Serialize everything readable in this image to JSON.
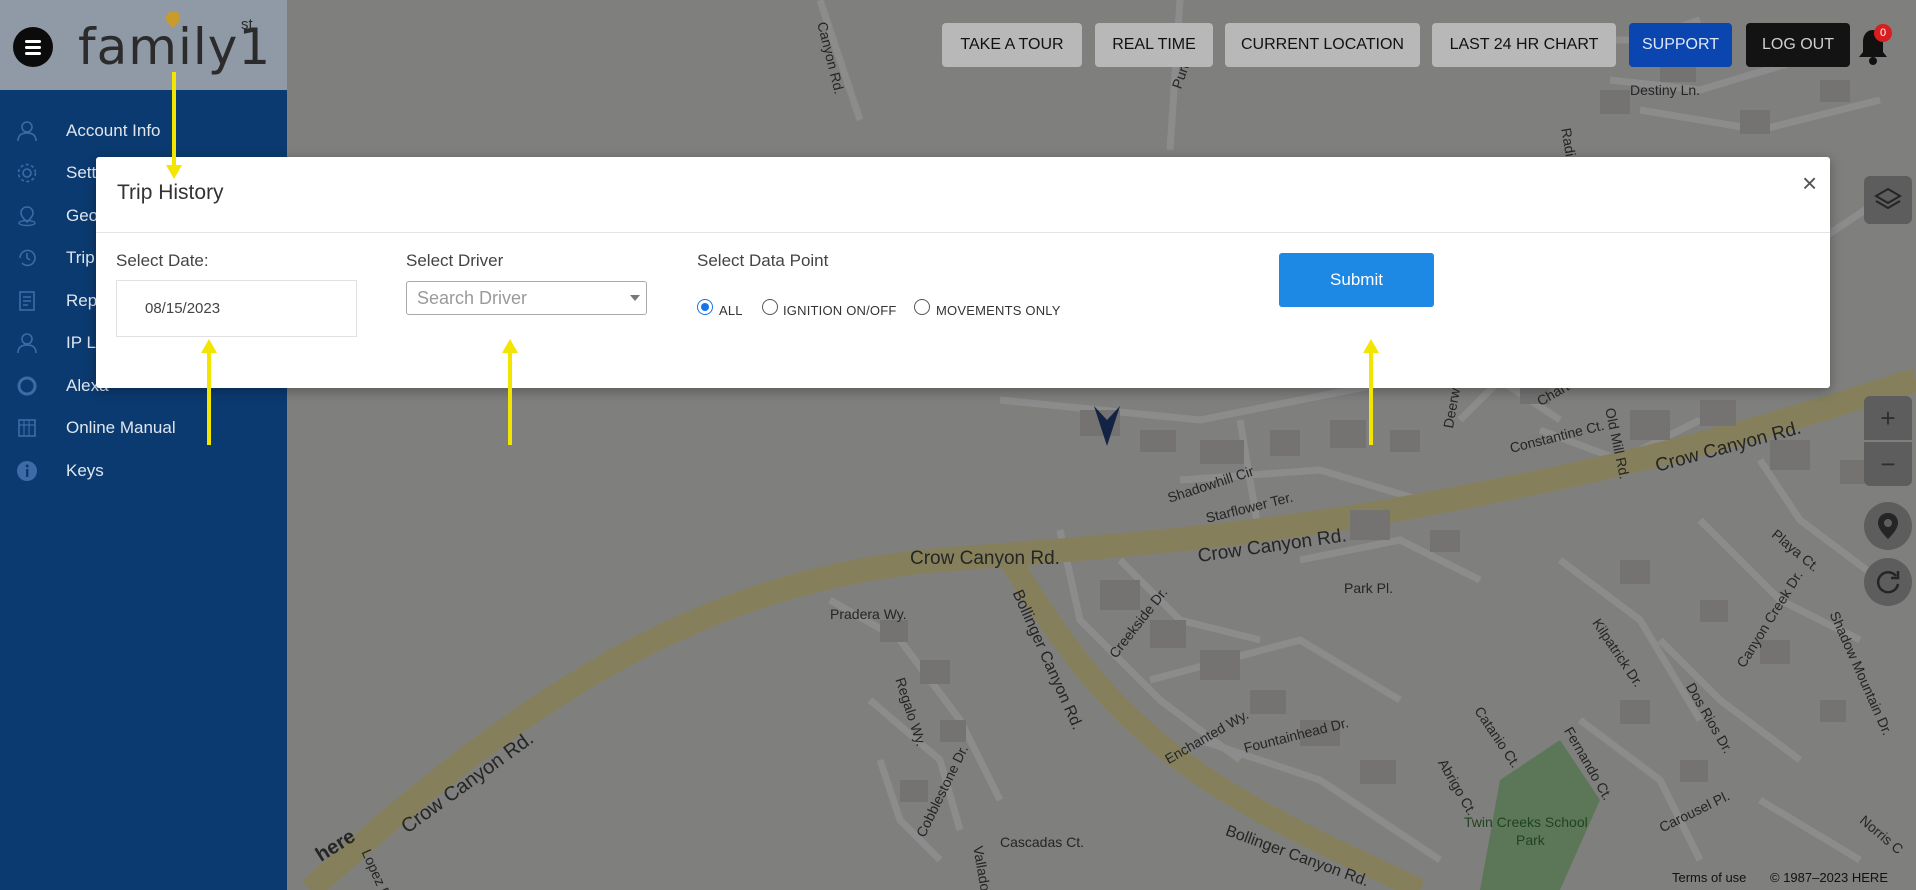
{
  "app": {
    "logo_text": "family1",
    "logo_sup": "st"
  },
  "sidebar": {
    "items": [
      {
        "label": "Account Info",
        "icon": "user-icon"
      },
      {
        "label": "Settings",
        "icon": "gear-icon"
      },
      {
        "label": "Geofence",
        "icon": "location-icon"
      },
      {
        "label": "Trip History",
        "icon": "history-icon"
      },
      {
        "label": "Reports",
        "icon": "report-icon"
      },
      {
        "label": "IP Log",
        "icon": "user-icon"
      },
      {
        "label": "Alexa",
        "icon": "alexa-icon"
      },
      {
        "label": "Online Manual",
        "icon": "manual-icon"
      },
      {
        "label": "Keys",
        "icon": "info-icon"
      }
    ]
  },
  "toolbar": {
    "take_tour": "TAKE A TOUR",
    "real_time": "REAL TIME",
    "current_location": "CURRENT LOCATION",
    "last_24": "LAST 24 HR CHART",
    "support": "SUPPORT",
    "logout": "LOG OUT",
    "notifications_count": "0"
  },
  "modal": {
    "title": "Trip History",
    "close": "×",
    "date_label": "Select Date:",
    "date_value": "08/15/2023",
    "driver_label": "Select Driver",
    "driver_placeholder": "Search Driver",
    "datapoint_label": "Select Data Point",
    "options": [
      "ALL",
      "IGNITION ON/OFF",
      "MOVEMENTS ONLY"
    ],
    "selected_option": "ALL",
    "submit": "Submit"
  },
  "map": {
    "labels": {
      "crow1": "Crow Canyon Rd.",
      "crow2": "Crow Canyon Rd.",
      "crow3": "Crow Canyon Rd.",
      "crow4": "Crow Canyon Rd.",
      "bollinger1": "Bollinger Canyon Rd.",
      "bollinger2": "Bollinger Canyon Rd.",
      "shadowhill": "Shadowhill Cir",
      "starflower": "Starflower Ter.",
      "parkpl": "Park Pl.",
      "pradera": "Pradera Wy.",
      "regalo": "Regalo Wy.",
      "creekside": "Creekside Dr.",
      "enchanted": "Enchanted Wy.",
      "fountainhead": "Fountainhead Dr.",
      "abrigo": "Abrigo Ct.",
      "catanio": "Catanio Ct.",
      "fernando": "Fernando Ct.",
      "kilpatrick": "Kilpatrick Dr.",
      "dosrios": "Dos Rios Dr.",
      "canyoncreek": "Canyon Creek Dr.",
      "shadowmountain": "Shadow Mountain Dr.",
      "playa": "Playa Ct.",
      "carousel": "Carousel Pl.",
      "norris": "Norris C",
      "twincreeks": "Twin Creeks School",
      "park": "Park",
      "cascadas": "Cascadas Ct.",
      "cobblestone": "Cobblestone Dr.",
      "valladolid": "Valladol",
      "lopez": "Lopez R",
      "constantine": "Constantine Ct.",
      "oldmill": "Old Mill Rd.",
      "deerwood": "Deerwood Rd.",
      "destiny": "Destiny Ln.",
      "radiant": "Radiant",
      "purdue": "Purdue Rd.",
      "canyonrd": "Canyon Rd.",
      "chartwell": "Chartwell",
      "here": "here",
      "terms": "Terms of use",
      "copyright": "© 1987–2023 HERE"
    }
  },
  "colors": {
    "sidebar": "#0b3a70",
    "support": "#0b45b0",
    "submit": "#1e88e5",
    "arrow": "#f2e600"
  }
}
